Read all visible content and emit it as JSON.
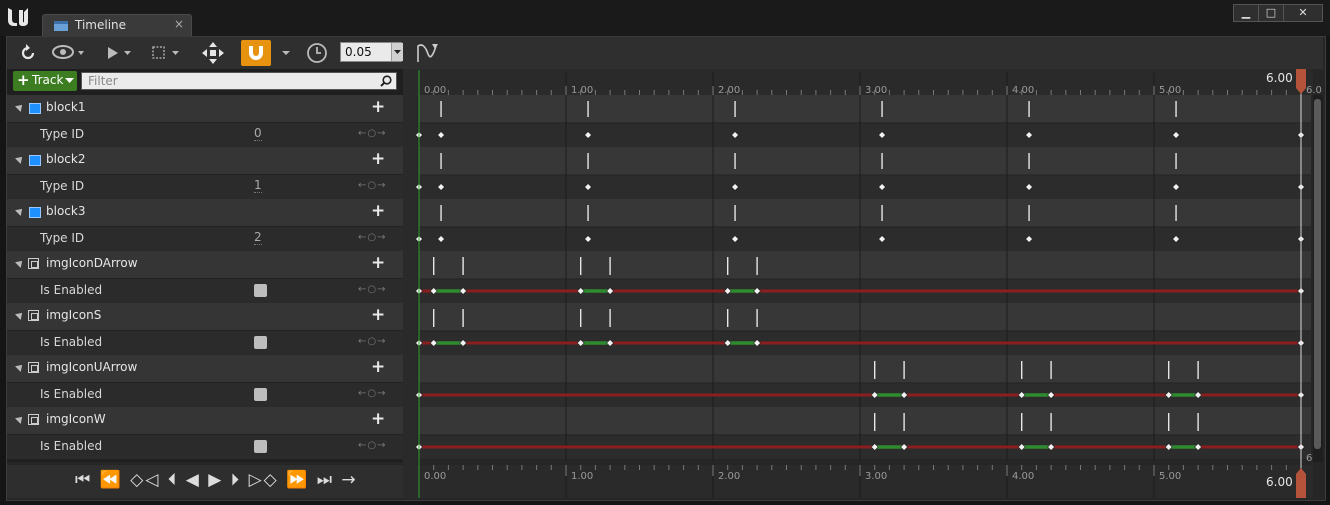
{
  "window": {
    "tab_title": "Timeline",
    "tab_close": "×",
    "minimize": "▁",
    "maximize": "□",
    "close": "✕"
  },
  "toolbar": {
    "snap_interval": "0.05",
    "icons": [
      "refresh-icon",
      "eye-icon",
      "play-icon",
      "selection-icon",
      "transform-icon",
      "magnet-icon",
      "clock-icon",
      "curve-icon"
    ]
  },
  "left_panel": {
    "add_track_label": "Track",
    "filter_placeholder": "Filter",
    "tracks": [
      {
        "name": "block1",
        "type": "block",
        "property": "Type ID",
        "value": "0"
      },
      {
        "name": "block2",
        "type": "block",
        "property": "Type ID",
        "value": "1"
      },
      {
        "name": "block3",
        "type": "block",
        "property": "Type ID",
        "value": "2"
      },
      {
        "name": "imgIconDArrow",
        "type": "image",
        "property": "Is Enabled",
        "value": false
      },
      {
        "name": "imgIconS",
        "type": "image",
        "property": "Is Enabled",
        "value": false
      },
      {
        "name": "imgIconUArrow",
        "type": "image",
        "property": "Is Enabled",
        "value": false
      },
      {
        "name": "imgIconW",
        "type": "image",
        "property": "Is Enabled",
        "value": false
      }
    ],
    "transport": "⏮ ⏪ ◇◁ ⏴ ◀ ▶ ⏵ ▷◇ ⏩ ⏭ →"
  },
  "timeline": {
    "ticks": [
      "0.00",
      "1.00",
      "2.00",
      "3.00",
      "4.00",
      "5.00"
    ],
    "end_time": "6.00",
    "end_label_small": "6.0",
    "start": 0,
    "end": 6,
    "colors": {
      "active": "#2e8b2e",
      "inactive": "#8b1e1e",
      "playhead": "#2ea02e",
      "end_marker": "#b5533a"
    },
    "typeid_keys": [
      0,
      0.15,
      1.15,
      2.15,
      3.15,
      4.15,
      5.15,
      6.0
    ],
    "bool_rows": [
      {
        "keys": [
          0.1,
          0.3,
          1.1,
          1.3,
          2.1,
          2.3
        ],
        "green": [
          [
            0.1,
            0.3
          ],
          [
            1.1,
            1.3
          ],
          [
            2.1,
            2.3
          ]
        ]
      },
      {
        "keys": [
          0.1,
          0.3,
          1.1,
          1.3,
          2.1,
          2.3
        ],
        "green": [
          [
            0.1,
            0.3
          ],
          [
            1.1,
            1.3
          ],
          [
            2.1,
            2.3
          ]
        ]
      },
      {
        "keys": [
          3.1,
          3.3,
          4.1,
          4.3,
          5.1,
          5.3
        ],
        "green": [
          [
            3.1,
            3.3
          ],
          [
            4.1,
            4.3
          ],
          [
            5.1,
            5.3
          ]
        ]
      },
      {
        "keys": [
          3.1,
          3.3,
          4.1,
          4.3,
          5.1,
          5.3
        ],
        "green": [
          [
            3.1,
            3.3
          ],
          [
            4.1,
            4.3
          ],
          [
            5.1,
            5.3
          ]
        ]
      }
    ]
  }
}
